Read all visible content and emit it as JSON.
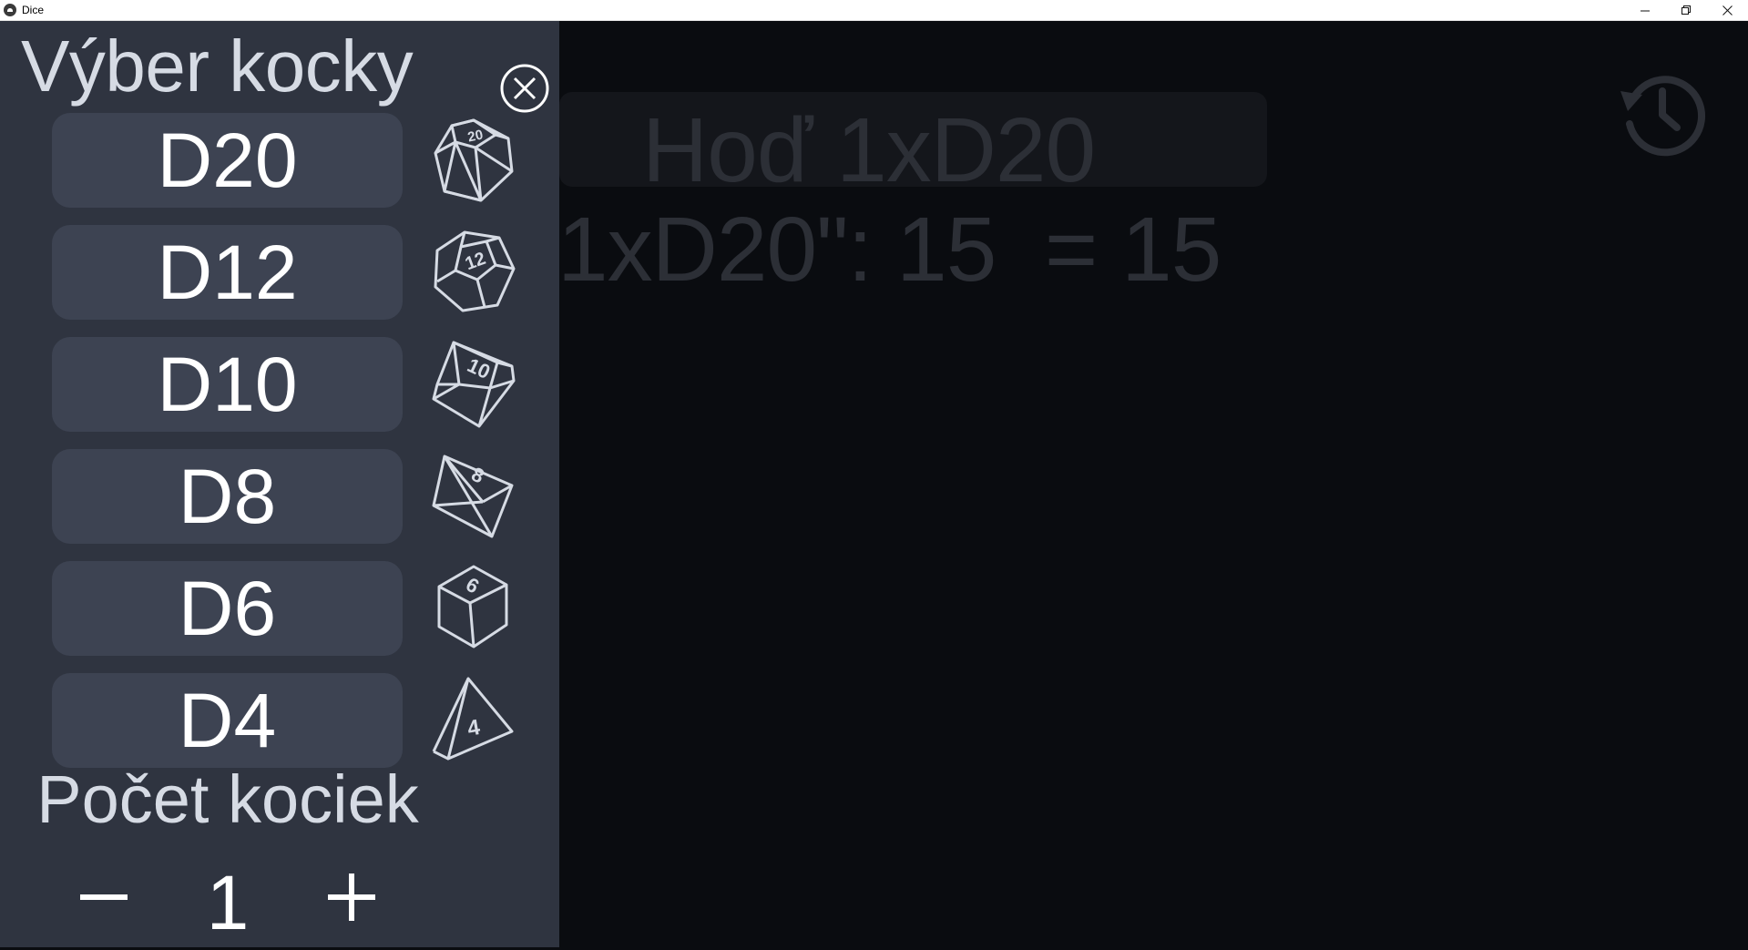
{
  "window": {
    "title": "Dice",
    "minimize_icon": "minimize-icon",
    "restore_icon": "restore-icon",
    "close_icon": "close-icon"
  },
  "background": {
    "roll_label": "Hoď 1xD20",
    "roll_result": "1xD20\": 15  = 15",
    "history_icon": "history-icon"
  },
  "panel": {
    "title": "Výber kocky",
    "close_icon": "close-circle-icon",
    "dice": [
      {
        "label": "D20",
        "icon": "d20-icon",
        "number": "20"
      },
      {
        "label": "D12",
        "icon": "d12-icon",
        "number": "12"
      },
      {
        "label": "D10",
        "icon": "d10-icon",
        "number": "10"
      },
      {
        "label": "D8",
        "icon": "d8-icon",
        "number": "8"
      },
      {
        "label": "D6",
        "icon": "d6-icon",
        "number": "6"
      },
      {
        "label": "D4",
        "icon": "d4-icon",
        "number": "4"
      }
    ],
    "count_label": "Počet kociek",
    "count_value": "1",
    "minus_icon": "minus-icon",
    "plus_icon": "plus-icon"
  },
  "colors": {
    "panel_bg": "#2f3440",
    "button_bg": "#3d4352",
    "main_bg": "#0a0c10",
    "dim_text": "#2c2f36",
    "icon_stroke": "#d6dbe4"
  }
}
